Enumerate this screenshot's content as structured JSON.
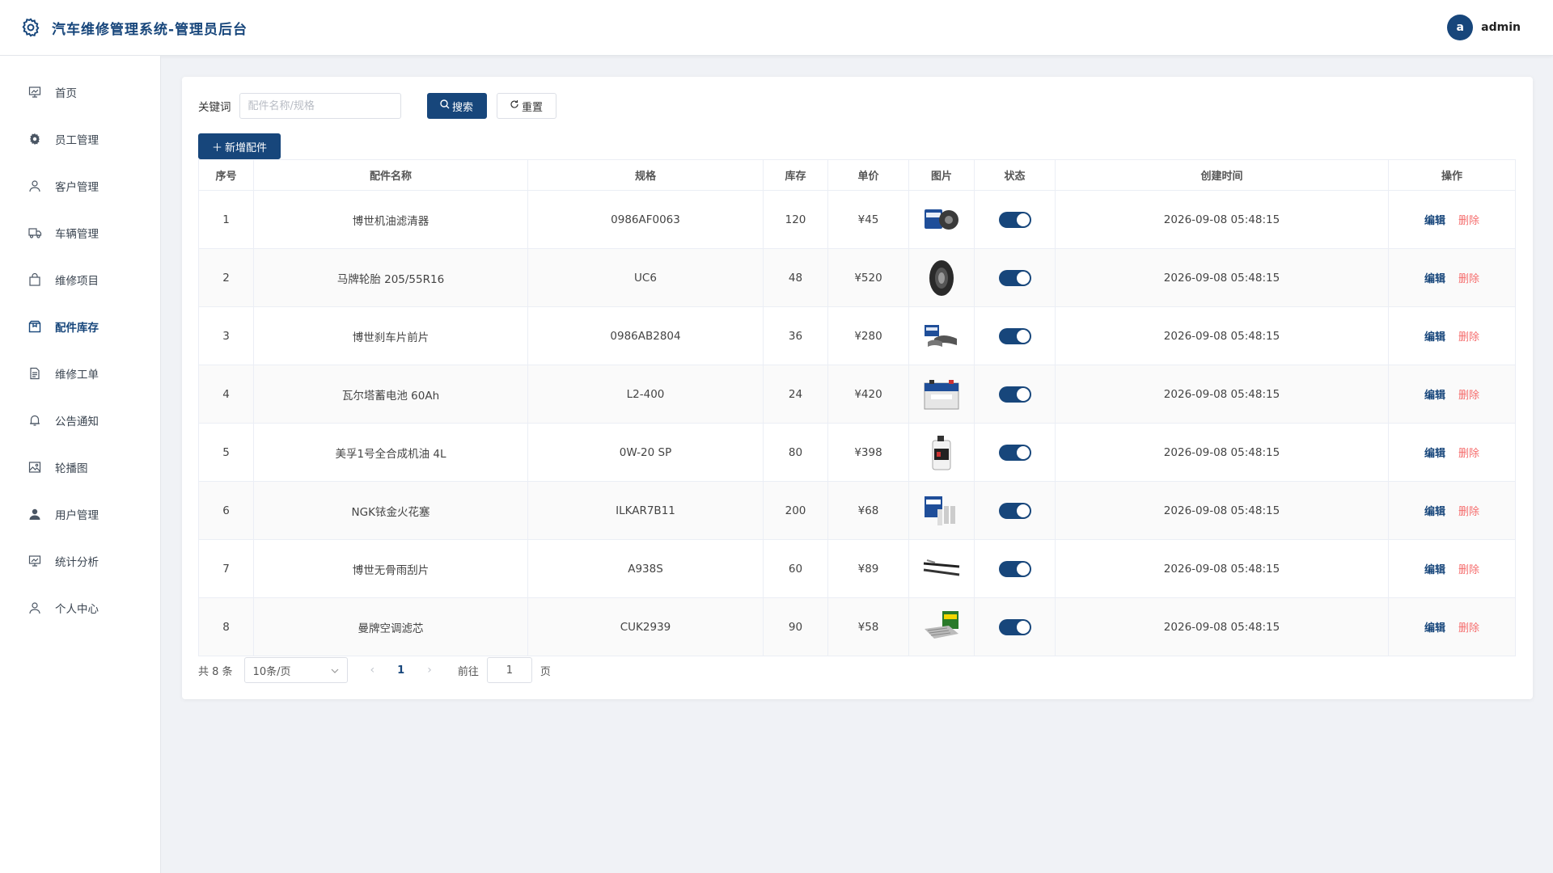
{
  "header": {
    "title": "汽车维修管理系统-管理员后台",
    "avatar_letter": "a",
    "username": "admin"
  },
  "sidebar": {
    "items": [
      {
        "label": "首页",
        "icon": "dashboard-icon"
      },
      {
        "label": "员工管理",
        "icon": "gear-icon"
      },
      {
        "label": "客户管理",
        "icon": "user-icon"
      },
      {
        "label": "车辆管理",
        "icon": "truck-icon"
      },
      {
        "label": "维修项目",
        "icon": "bag-icon"
      },
      {
        "label": "配件库存",
        "icon": "box-icon",
        "active": true
      },
      {
        "label": "维修工单",
        "icon": "document-icon"
      },
      {
        "label": "公告通知",
        "icon": "bell-icon"
      },
      {
        "label": "轮播图",
        "icon": "picture-icon"
      },
      {
        "label": "用户管理",
        "icon": "user-filled-icon"
      },
      {
        "label": "统计分析",
        "icon": "chart-icon"
      },
      {
        "label": "个人中心",
        "icon": "user-icon"
      }
    ]
  },
  "search": {
    "label": "关键词",
    "placeholder": "配件名称/规格",
    "search_label": "搜索",
    "reset_label": "重置",
    "add_label": "新增配件"
  },
  "table": {
    "headers": [
      "序号",
      "配件名称",
      "规格",
      "库存",
      "单价",
      "图片",
      "状态",
      "创建时间",
      "操作"
    ],
    "edit_label": "编辑",
    "delete_label": "删除",
    "rows": [
      {
        "no": "1",
        "name": "博世机油滤清器",
        "spec": "0986AF0063",
        "stock": "120",
        "price": "¥45",
        "image": "oil-filter",
        "status": true,
        "created": "2026-09-08 05:48:15"
      },
      {
        "no": "2",
        "name": "马牌轮胎 205/55R16",
        "spec": "UC6",
        "stock": "48",
        "price": "¥520",
        "image": "tire",
        "status": true,
        "created": "2026-09-08 05:48:15"
      },
      {
        "no": "3",
        "name": "博世刹车片前片",
        "spec": "0986AB2804",
        "stock": "36",
        "price": "¥280",
        "image": "brake-pads",
        "status": true,
        "created": "2026-09-08 05:48:15"
      },
      {
        "no": "4",
        "name": "瓦尔塔蓄电池 60Ah",
        "spec": "L2-400",
        "stock": "24",
        "price": "¥420",
        "image": "battery",
        "status": true,
        "created": "2026-09-08 05:48:15"
      },
      {
        "no": "5",
        "name": "美孚1号全合成机油 4L",
        "spec": "0W-20 SP",
        "stock": "80",
        "price": "¥398",
        "image": "engine-oil",
        "status": true,
        "created": "2026-09-08 05:48:15"
      },
      {
        "no": "6",
        "name": "NGK铱金火花塞",
        "spec": "ILKAR7B11",
        "stock": "200",
        "price": "¥68",
        "image": "spark-plug",
        "status": true,
        "created": "2026-09-08 05:48:15"
      },
      {
        "no": "7",
        "name": "博世无骨雨刮片",
        "spec": "A938S",
        "stock": "60",
        "price": "¥89",
        "image": "wiper",
        "status": true,
        "created": "2026-09-08 05:48:15"
      },
      {
        "no": "8",
        "name": "曼牌空调滤芯",
        "spec": "CUK2939",
        "stock": "90",
        "price": "¥58",
        "image": "cabin-filter",
        "status": true,
        "created": "2026-09-08 05:48:15"
      }
    ]
  },
  "pagination": {
    "total": "共 8 条",
    "page_size": "10条/页",
    "current": "1",
    "goto_label": "前往",
    "goto_value": "1",
    "page_suffix": "页"
  },
  "colors": {
    "primary": "#17467b",
    "danger": "#f56c6c"
  }
}
